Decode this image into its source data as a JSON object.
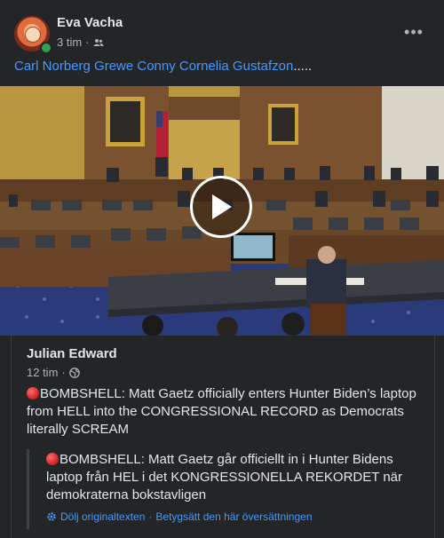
{
  "post": {
    "author": "Eva Vacha",
    "time": "3 tim",
    "separator": "·",
    "audience_icon": "friends-icon",
    "more_icon": "more-horizontal-icon",
    "more_label": "•••",
    "mentions": "Carl Norberg Grewe Conny Cornelia Gustafzon",
    "mentions_suffix": "....."
  },
  "video": {
    "play_icon": "play-icon"
  },
  "shared_post": {
    "author": "Julian Edward",
    "time": "12 tim",
    "separator": "·",
    "audience_icon": "globe-icon",
    "text": "BOMBSHELL: Matt Gaetz officially enters Hunter Biden’s laptop from HELL into the CONGRESSIONAL RECORD as Democrats literally SCREAM",
    "translation": "BOMBSHELL: Matt Gaetz går officiellt in i Hunter Bidens laptop från HEL i det KONGRESSIONELLA REKORDET när demokraterna bokstavligen",
    "hide_original": "Dölj originaltexten",
    "link_separator": "·",
    "rate_translation": "Betygsätt den här översättningen"
  },
  "colors": {
    "background": "#242526",
    "text": "#e4e6eb",
    "secondary_text": "#b0b3b8",
    "link": "#4599ff",
    "online": "#31a24c"
  }
}
